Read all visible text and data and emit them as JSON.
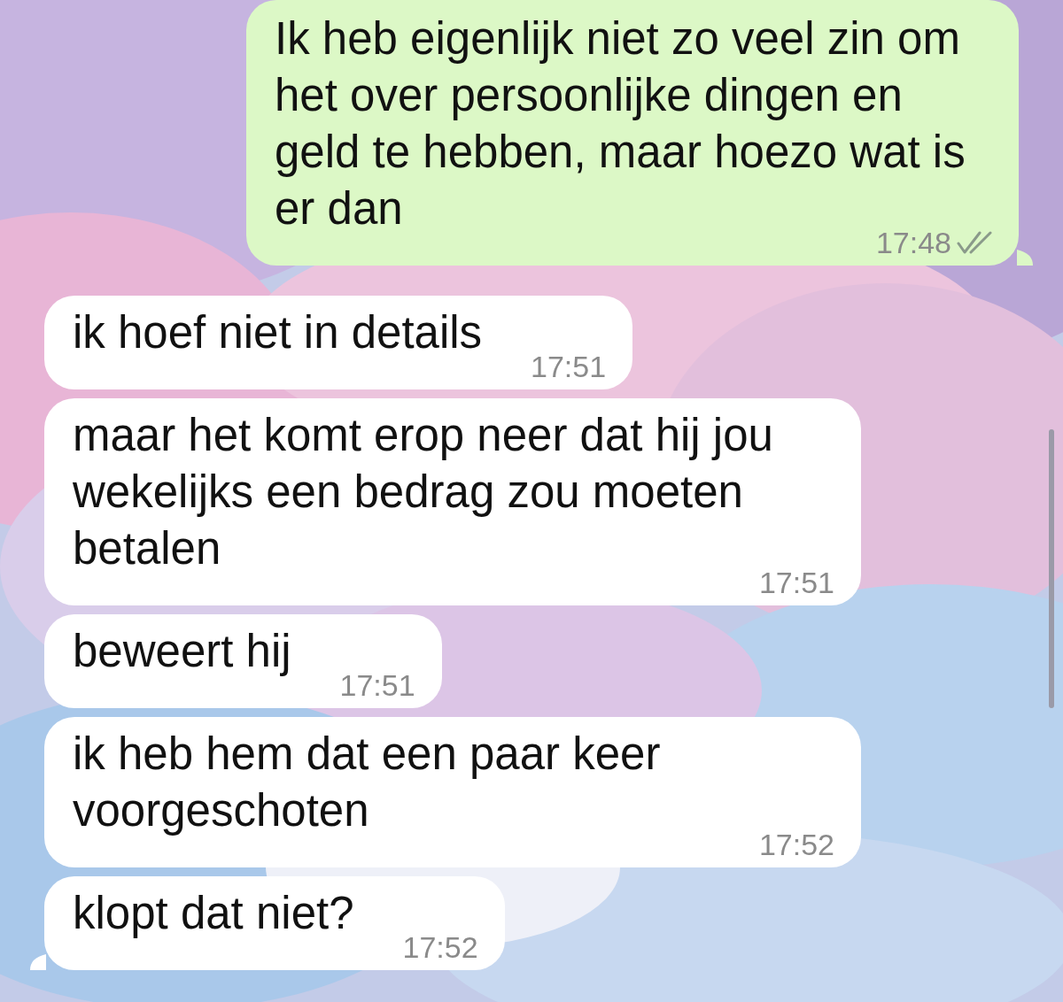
{
  "messages": [
    {
      "kind": "sent",
      "text": "Ik heb eigenlijk niet zo veel zin om het over persoonlijke dingen en geld te hebben, maar hoezo wat is er dan",
      "time": "17:48",
      "read": false,
      "tail": true
    },
    {
      "kind": "received",
      "text": "ik hoef niet in details",
      "time": "17:51",
      "tail": false
    },
    {
      "kind": "received",
      "text": "maar het komt erop neer dat hij jou wekelijks een bedrag zou moeten betalen",
      "time": "17:51",
      "tail": false
    },
    {
      "kind": "received",
      "text": "beweert hij",
      "time": "17:51",
      "tail": false
    },
    {
      "kind": "received",
      "text": "ik heb hem dat een paar keer voorgeschoten",
      "time": "17:52",
      "tail": false
    },
    {
      "kind": "received",
      "text": "klopt dat niet?",
      "time": "17:52",
      "tail": true
    }
  ]
}
